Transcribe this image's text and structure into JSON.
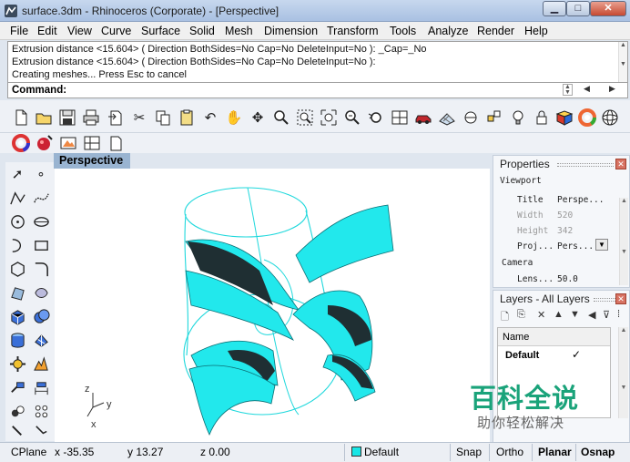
{
  "window": {
    "title": "surface.3dm - Rhinoceros (Corporate) - [Perspective]",
    "min_label": "▁",
    "max_label": "□",
    "close_label": "✕"
  },
  "menu": [
    "File",
    "Edit",
    "View",
    "Curve",
    "Surface",
    "Solid",
    "Mesh",
    "Dimension",
    "Transform",
    "Tools",
    "Analyze",
    "Render",
    "Help"
  ],
  "command": {
    "history": [
      "Extrusion distance <15.604> ( Direction  BothSides=No  Cap=No  DeleteInput=No ): _Cap=_No",
      "Extrusion distance <15.604> ( Direction  BothSides=No  Cap=No  DeleteInput=No ):",
      "Creating meshes... Press Esc to cancel"
    ],
    "prompt": "Command:"
  },
  "toolbar_main_icons": [
    "new-file-icon",
    "open-folder-icon",
    "save-icon",
    "print-icon",
    "import-icon",
    "cut-icon",
    "copy-icon",
    "paste-icon",
    "undo-icon",
    "pan-hand-icon",
    "rotate-view-icon",
    "zoom-icon",
    "zoom-window-icon",
    "zoom-extents-icon",
    "zoom-selected-icon",
    "undo-view-icon",
    "four-viewports-icon",
    "car-icon",
    "grid-icon",
    "point-edit-icon",
    "properties-icon",
    "light-bulb-icon",
    "lock-icon",
    "render-icon",
    "color-wheel-icon",
    "sphere-icon"
  ],
  "toolbar_secondary_icons": [
    "color-wheel-icon",
    "material-icon",
    "render-tools-icon",
    "viewport-layout-icon",
    "page-icon"
  ],
  "toolbox_icons": [
    "select-arrow-icon",
    "point-icon",
    "polyline-icon",
    "curve-icon",
    "circle-icon",
    "ellipse-icon",
    "arc-icon",
    "rectangle-icon",
    "polygon-icon",
    "fillet-curve-icon",
    "surface-corners-icon",
    "edit-surface-icon",
    "box-icon",
    "boolean-union-icon",
    "cylinder-icon",
    "mesh-icon",
    "transform-icon",
    "explode-icon",
    "analyze-icon",
    "dimension-icon",
    "group-icon",
    "array-icon",
    "extra-tool-icon",
    "extra-tool-2-icon"
  ],
  "viewport": {
    "name": "Perspective",
    "axis_x": "x",
    "axis_y": "y",
    "axis_z": "z"
  },
  "properties": {
    "title": "Properties",
    "section_viewport": "Viewport",
    "rows": [
      {
        "label": "Title",
        "value": "Perspe..."
      },
      {
        "label": "Width",
        "value": "520"
      },
      {
        "label": "Height",
        "value": "342"
      },
      {
        "label": "Proj...",
        "value": "Pers..."
      }
    ],
    "section_camera": "Camera",
    "lens_label": "Lens...",
    "lens_value": "50.0"
  },
  "layers": {
    "title": "Layers - All Layers",
    "column_name": "Name",
    "rows": [
      {
        "name": "Default",
        "current": "✓"
      }
    ]
  },
  "watermark": {
    "line1": "百科全说",
    "line2": "助你轻松解决"
  },
  "status": {
    "cplane": "CPlane",
    "x": "x -35.35",
    "y": "y 13.27",
    "z": "z 0.00",
    "layer": "Default",
    "layer_color": "#18e6e6",
    "snap": "Snap",
    "ortho": "Ortho",
    "planar": "Planar",
    "osnap": "Osnap"
  },
  "colors": {
    "surface_cyan": "#22e8ec",
    "surface_dark": "#1f2f33",
    "viewport_tab": "#99b4d1"
  }
}
